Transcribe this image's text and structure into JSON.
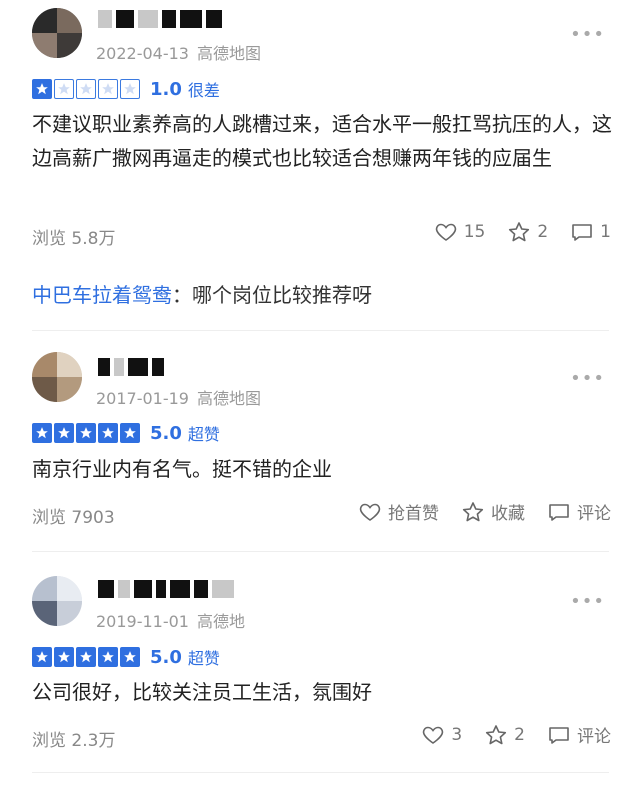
{
  "reviews": [
    {
      "date": "2022-04-13",
      "source": "高德地图",
      "score": "1.0",
      "score_label": "很差",
      "stars_filled": 1,
      "content": "不建议职业素养高的人跳槽过来，适合水平一般扛骂抗压的人，这边高薪广撒网再逼走的模式也比较适合想赚两年钱的应届生",
      "views": "浏览 5.8万",
      "like_count": "15",
      "fav_count": "2",
      "comment_count": "1"
    },
    {
      "date": "2017-01-19",
      "source": "高德地图",
      "score": "5.0",
      "score_label": "超赞",
      "stars_filled": 5,
      "content": "南京行业内有名气。挺不错的企业",
      "views": "浏览 7903",
      "like_label": "抢首赞",
      "fav_label": "收藏",
      "comment_label": "评论"
    },
    {
      "date": "2019-11-01",
      "source": "高德地",
      "score": "5.0",
      "score_label": "超赞",
      "stars_filled": 5,
      "content": "公司很好，比较关注员工生活，氛围好",
      "views": "浏览 2.3万",
      "like_count": "3",
      "fav_count": "2",
      "comment_label": "评论"
    }
  ],
  "reply": {
    "author": "中巴车拉着鸳鸯",
    "separator": "：",
    "text": "哪个岗位比较推荐呀"
  },
  "more_glyph": "•••",
  "colors": {
    "accent": "#2f6fe0",
    "meta": "#999999"
  },
  "icons": [
    "heart-icon",
    "star-outline-icon",
    "comment-icon",
    "more-icon"
  ]
}
